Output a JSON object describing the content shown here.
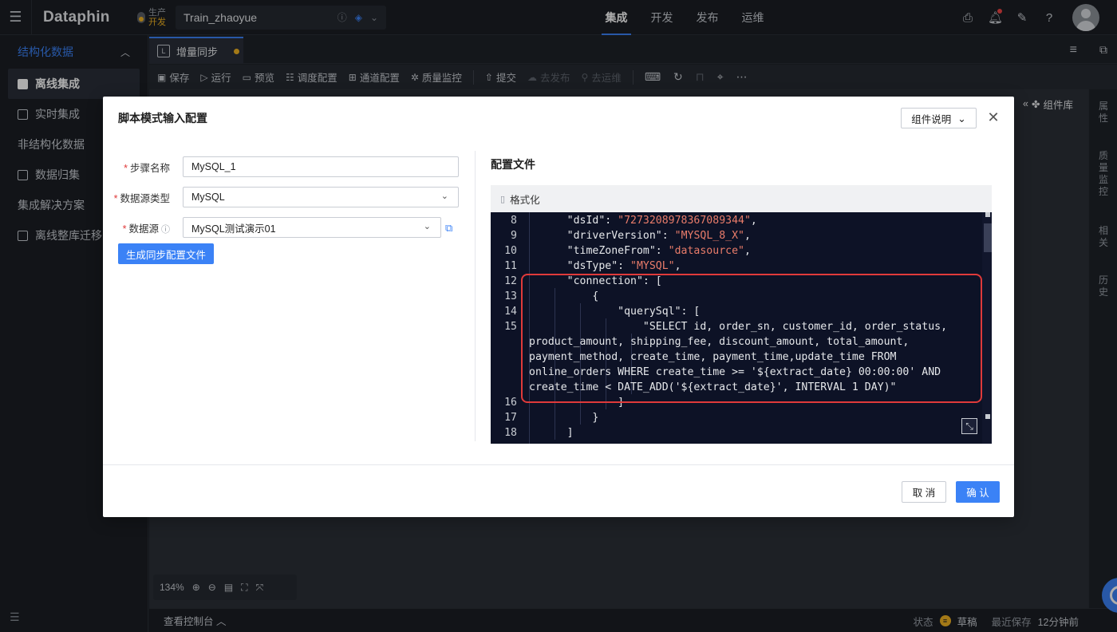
{
  "app": {
    "logo": "Dataphin",
    "env_primary": "生产",
    "env_secondary": "开发",
    "project_name": "Train_zhaoyue",
    "nav": [
      "集成",
      "开发",
      "发布",
      "运维"
    ],
    "active_nav": "集成"
  },
  "sidebar": {
    "section_title": "结构化数据",
    "items": [
      {
        "label": "离线集成",
        "active": true
      },
      {
        "label": "实时集成"
      },
      {
        "label": "非结构化数据"
      },
      {
        "label": "数据归集"
      },
      {
        "label": "集成解决方案"
      },
      {
        "label": "离线整库迁移"
      }
    ]
  },
  "editor": {
    "tab_label": "增量同步",
    "toolbar": {
      "save": "保存",
      "run": "运行",
      "preview": "预览",
      "schedule": "调度配置",
      "channel": "通道配置",
      "quality": "质量监控",
      "submit": "提交",
      "publish": "去发布",
      "ops": "去运维"
    },
    "component_lib": "组件库",
    "right_panel": [
      "属性",
      "质量监控",
      "相关",
      "历史"
    ],
    "zoom": "134%",
    "console": "查看控制台",
    "status_label": "状态",
    "status_value": "草稿",
    "last_saved_label": "最近保存",
    "last_saved_value": "12分钟前"
  },
  "modal": {
    "title": "脚本模式输入配置",
    "help_button": "组件说明",
    "fields": {
      "step_name_label": "步骤名称",
      "step_name_value": "MySQL_1",
      "ds_type_label": "数据源类型",
      "ds_type_value": "MySQL",
      "ds_label": "数据源",
      "ds_value": "MySQL测试演示01"
    },
    "generate_button": "生成同步配置文件",
    "config_title": "配置文件",
    "format_button": "格式化",
    "cancel_button": "取 消",
    "confirm_button": "确 认"
  },
  "code": {
    "lines": [
      {
        "n": "8",
        "text": "      \"dsId\": \"7273208978367089344\","
      },
      {
        "n": "9",
        "text": "      \"driverVersion\": \"MYSQL_8_X\","
      },
      {
        "n": "10",
        "text": "      \"timeZoneFrom\": \"datasource\","
      },
      {
        "n": "11",
        "text": "      \"dsType\": \"MYSQL\","
      },
      {
        "n": "12",
        "text": "      \"connection\": ["
      },
      {
        "n": "13",
        "text": "          {"
      },
      {
        "n": "14",
        "text": "              \"querySql\": ["
      },
      {
        "n": "15",
        "text": "                  \"SELECT id, order_sn, customer_id, order_status,"
      },
      {
        "n": "",
        "text": "product_amount, shipping_fee, discount_amount, total_amount,"
      },
      {
        "n": "",
        "text": "payment_method, create_time, payment_time,update_time FROM"
      },
      {
        "n": "",
        "text": "online_orders WHERE create_time >= '${extract_date} 00:00:00' AND"
      },
      {
        "n": "",
        "text": "create_time < DATE_ADD('${extract_date}', INTERVAL 1 DAY)\""
      },
      {
        "n": "16",
        "text": "              ]"
      },
      {
        "n": "17",
        "text": "          }"
      },
      {
        "n": "18",
        "text": "      ]"
      }
    ]
  }
}
